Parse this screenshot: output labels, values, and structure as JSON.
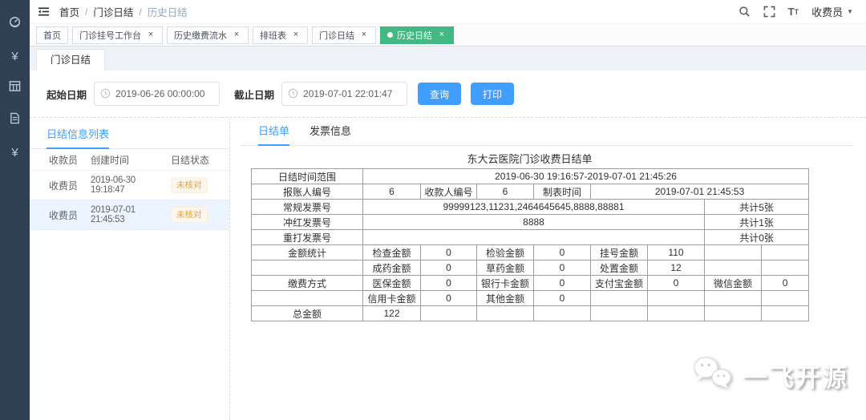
{
  "glyphs": {
    "yen": "¥",
    "caret_down": "▼",
    "close": "×",
    "slash": "/",
    "dot": "●"
  },
  "colors": {
    "primary_blue": "#409eff",
    "active_tag_green": "#42b983",
    "sidebar_bg": "#304156",
    "warning_text": "#e6a23c",
    "warning_bg": "#fdf6ec",
    "selected_row_bg": "#ecf5ff"
  },
  "navbar": {
    "breadcrumb": [
      "首页",
      "门诊日结",
      "历史日结"
    ],
    "user_label": "收费员"
  },
  "sidebar_icons": [
    "dashboard-icon",
    "currency-yen-icon",
    "table-grid-icon",
    "document-icon",
    "currency-yen-icon"
  ],
  "tags": [
    {
      "label": "首页",
      "closable": false,
      "active": false
    },
    {
      "label": "门诊挂号工作台",
      "closable": true,
      "active": false
    },
    {
      "label": "历史缴费流水",
      "closable": true,
      "active": false
    },
    {
      "label": "排班表",
      "closable": true,
      "active": false
    },
    {
      "label": "门诊日结",
      "closable": true,
      "active": false
    },
    {
      "label": "历史日结",
      "closable": true,
      "active": true
    }
  ],
  "page_tab_label": "门诊日结",
  "filter": {
    "start_label": "起始日期",
    "start_value": "2019-06-26 00:00:00",
    "end_label": "截止日期",
    "end_value": "2019-07-01 22:01:47",
    "query_button": "查询",
    "print_button": "打印"
  },
  "left_panel": {
    "title": "日结信息列表",
    "columns": [
      "收款员",
      "创建时间",
      "日结状态"
    ],
    "rows": [
      {
        "cashier": "收费员",
        "created": "2019-06-30 19:18:47",
        "status": "未核对",
        "selected": false
      },
      {
        "cashier": "收费员",
        "created": "2019-07-01 21:45:53",
        "status": "未核对",
        "selected": true
      }
    ]
  },
  "right_panel": {
    "tabs": [
      {
        "label": "日结单",
        "active": true
      },
      {
        "label": "发票信息",
        "active": false
      }
    ],
    "report_title": "东大云医院门诊收费日结单",
    "report_table": {
      "rows": [
        [
          {
            "t": "日结时间范围",
            "h": true
          },
          {
            "t": "2019-06-30 19:16:57-2019-07-01 21:45:26",
            "span": 8
          }
        ],
        [
          {
            "t": "报账人编号",
            "h": true
          },
          {
            "t": "6"
          },
          {
            "t": "收款人编号",
            "h": true
          },
          {
            "t": "6"
          },
          {
            "t": "制表时间",
            "h": true
          },
          {
            "t": "2019-07-01 21:45:53",
            "span": 4
          }
        ],
        [
          {
            "t": "常规发票号",
            "h": true
          },
          {
            "t": "99999123,11231,2464645645,8888,88881",
            "span": 6
          },
          {
            "t": "共计5张",
            "span": 2
          }
        ],
        [
          {
            "t": "冲红发票号",
            "h": true
          },
          {
            "t": "8888",
            "span": 6
          },
          {
            "t": "共计1张",
            "span": 2
          }
        ],
        [
          {
            "t": "重打发票号",
            "h": true
          },
          {
            "t": "",
            "span": 6
          },
          {
            "t": "共计0张",
            "span": 2
          }
        ],
        [
          {
            "t": "金额统计",
            "h": true
          },
          {
            "t": "检查金额",
            "h": true
          },
          {
            "t": "0"
          },
          {
            "t": "检验金额",
            "h": true
          },
          {
            "t": "0"
          },
          {
            "t": "挂号金额",
            "h": true
          },
          {
            "t": "110"
          },
          {
            "t": ""
          },
          {
            "t": ""
          }
        ],
        [
          {
            "t": ""
          },
          {
            "t": "成药金额",
            "h": true
          },
          {
            "t": "0"
          },
          {
            "t": "草药金额",
            "h": true
          },
          {
            "t": "0"
          },
          {
            "t": "处置金额",
            "h": true
          },
          {
            "t": "12"
          },
          {
            "t": ""
          },
          {
            "t": ""
          }
        ],
        [
          {
            "t": "缴费方式",
            "h": true
          },
          {
            "t": "医保金额",
            "h": true
          },
          {
            "t": "0"
          },
          {
            "t": "银行卡金额",
            "h": true
          },
          {
            "t": "0"
          },
          {
            "t": "支付宝金额",
            "h": true
          },
          {
            "t": "0"
          },
          {
            "t": "微信金额",
            "h": true
          },
          {
            "t": "0"
          }
        ],
        [
          {
            "t": ""
          },
          {
            "t": "信用卡金额",
            "h": true
          },
          {
            "t": "0"
          },
          {
            "t": "其他金额",
            "h": true
          },
          {
            "t": "0"
          },
          {
            "t": ""
          },
          {
            "t": ""
          },
          {
            "t": ""
          },
          {
            "t": ""
          }
        ],
        [
          {
            "t": "总金额",
            "h": true
          },
          {
            "t": "122"
          },
          {
            "t": ""
          },
          {
            "t": ""
          },
          {
            "t": ""
          },
          {
            "t": ""
          },
          {
            "t": ""
          },
          {
            "t": ""
          },
          {
            "t": ""
          }
        ]
      ]
    }
  },
  "watermark_text": "一飞开源"
}
